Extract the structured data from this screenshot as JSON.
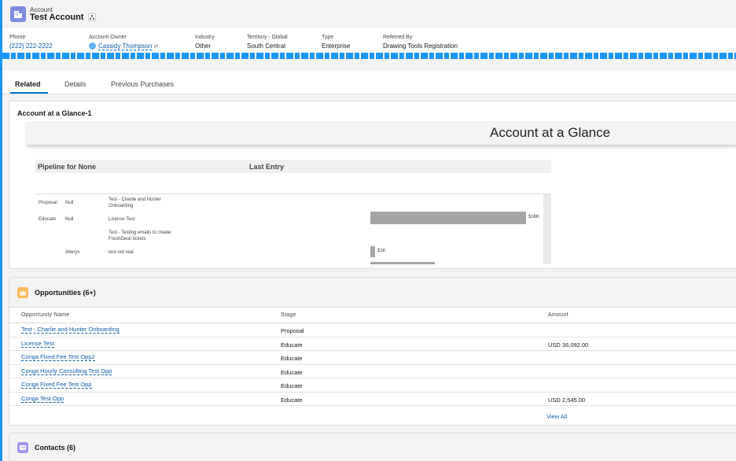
{
  "header": {
    "object_type": "Account",
    "account_name": "Test Account",
    "fields": [
      {
        "label": "Phone",
        "value": "(222) 222-2222"
      },
      {
        "label": "Account Owner",
        "value": "Cassidy Thompson"
      },
      {
        "label": "Industry",
        "value": "Other"
      },
      {
        "label": "Territory - Global",
        "value": "South Central"
      },
      {
        "label": "Type",
        "value": "Enterprise"
      },
      {
        "label": "Referred By",
        "value": "Drawing Tools Registration"
      }
    ]
  },
  "tabs": [
    {
      "label": "Related",
      "active": true
    },
    {
      "label": "Details",
      "active": false
    },
    {
      "label": "Previous Purchases",
      "active": false
    }
  ],
  "glance": {
    "card_title": "Account at a Glance-1",
    "banner_title": "Account at a Glance",
    "table_headers": [
      "Pipeline for None",
      "Last Entry"
    ],
    "rows": [
      {
        "stage": "Proposal",
        "owner": "Null",
        "entries": [
          "Test - Charlie and Hunter",
          "Onboarding"
        ]
      },
      {
        "stage": "Educate",
        "owner": "Null",
        "entries": [
          "License Test"
        ],
        "bar_value": "$36K"
      },
      {
        "stage": "",
        "owner": "",
        "entries": [
          "Test - Testing emails to create",
          "FreshDesk tickets"
        ]
      },
      {
        "stage": "",
        "owner": "Alteryx",
        "entries": [
          "test-not real"
        ],
        "bar_value": "$1K"
      }
    ],
    "bars": [
      {
        "label": "$36K",
        "value": 36
      },
      {
        "label": "$1K",
        "value": 1
      }
    ]
  },
  "opportunities": {
    "title": "Opportunities (6+)",
    "columns": [
      "Opportunity Name",
      "Stage",
      "Amount"
    ],
    "rows": [
      {
        "name": "Test - Charlie and Hunter Onboarding",
        "stage": "Proposal",
        "amount": ""
      },
      {
        "name": "License Test",
        "stage": "Educate",
        "amount": "USD 36,092.00"
      },
      {
        "name": "Conga Fixed Fee Test Opp2",
        "stage": "Educate",
        "amount": ""
      },
      {
        "name": "Conga Hourly Consulting Test Opp",
        "stage": "Educate",
        "amount": ""
      },
      {
        "name": "Conga Fixed Fee Test Opp",
        "stage": "Educate",
        "amount": ""
      },
      {
        "name": "Conga Test Opp",
        "stage": "Educate",
        "amount": "USD 2,545.00"
      }
    ],
    "view_all": "View All"
  },
  "contacts": {
    "title": "Contacts (6)"
  },
  "colors": {
    "accent": "#0176d3",
    "link": "#0b5cab",
    "account_icon": "#7f8de1",
    "opportunity_icon": "#fcb95b",
    "contact_icon": "#a094ed",
    "bar": "#a5a5a5"
  },
  "icons": {
    "account": "building-icon",
    "hierarchy": "hierarchy-icon",
    "owner": "user-avatar-icon",
    "opportunity": "crown-icon",
    "contact": "contact-card-icon"
  }
}
